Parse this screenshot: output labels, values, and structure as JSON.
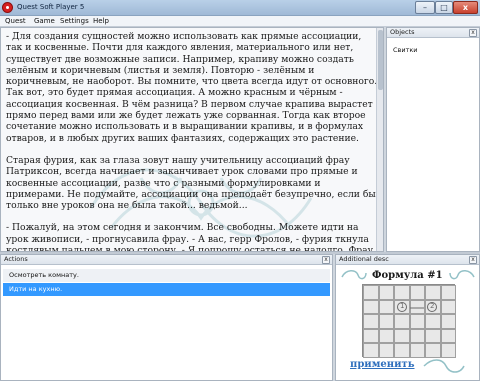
{
  "window": {
    "title": "Quest Soft Player 5",
    "min_glyph": "–",
    "max_glyph": "□",
    "close_glyph": "x"
  },
  "menu": {
    "items": [
      "Quest",
      "Game",
      "Settings",
      "Help"
    ]
  },
  "main": {
    "paragraphs": [
      "- Для создания сущностей можно использовать как прямые ассоциации, так и косвенные. Почти для каждого явления, материального или нет, существует две возможные записи. Например, крапиву можно создать зелёным и коричневым (листья и земля). Повторю - зелёным и коричневым, не наоборот. Вы помните, что цвета всегда идут от основного. Так вот, это будет прямая ассоциация. А можно красным и чёрным - ассоциация косвенная. В чём разница? В первом случае крапива вырастет прямо перед вами или же будет лежать уже сорванная. Тогда как второе сочетание можно использовать и в выращивании крапивы, и в формулах отваров, и в любых других ваших фантазиях, содержащих это растение.",
      "Старая фурия, как за глаза зовут нашу учительницу ассоциаций фрау Патриксон, всегда начинает и заканчивает урок словами про прямые и косвенные ассоциации, разве что с разными формулировками и примерами. Не подумайте, ассоциации она преподаёт безупречно, если бы только вне уроков она не была такой... ведьмой...",
      "- Пожалуй, на этом сегодня и закончим. Все свободны. Можете идти на урок живописи, - прогнусавила фрау. - А вас, герр Фролов, - фурия ткнула костлявым пальцем в мою сторону, - Я попрошу остаться не надолго. Фрау Матте просила"
    ]
  },
  "objects": {
    "header": "Objects",
    "close_glyph": "x",
    "items": [
      "Свитки"
    ]
  },
  "actions": {
    "header": "Actions",
    "close_glyph": "x",
    "items": [
      "Осмотреть комнату.",
      "Идти на кухню."
    ],
    "selected_index": 1
  },
  "desc": {
    "header": "Additional desc",
    "close_glyph": "x",
    "formula_title": "Формула #1",
    "grid_marks": [
      "1",
      "2"
    ],
    "apply_label": "применить"
  },
  "colors": {
    "selection": "#3399ff",
    "link": "#2f6fbd"
  }
}
